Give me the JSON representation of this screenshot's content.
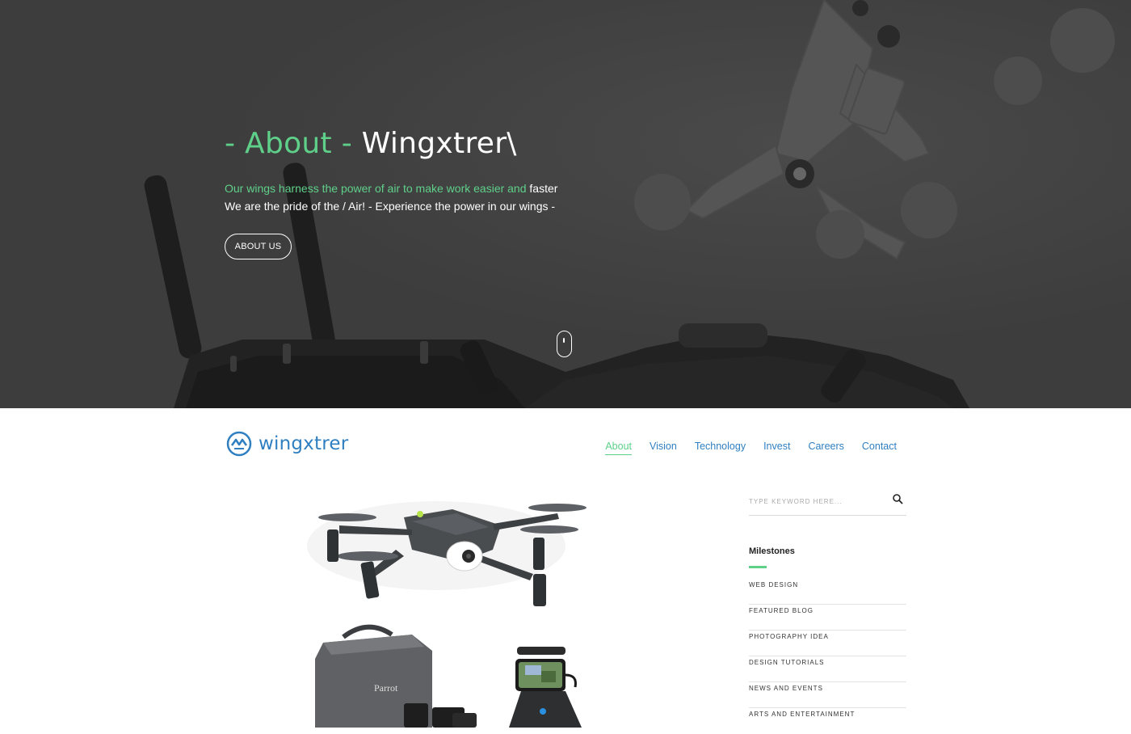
{
  "hero": {
    "title_prefix": "- About -",
    "title_main": " Wingxtrer\\",
    "line1_accent": "Our wings harness the power of air to make work easier and",
    "line1_rest": " faster",
    "line2": "We are the pride of the / Air! - Experience the power in our wings -",
    "button_label": "ABOUT US"
  },
  "header": {
    "brand": "wingxtrer",
    "nav": [
      {
        "label": "About",
        "active": true
      },
      {
        "label": "Vision"
      },
      {
        "label": "Technology"
      },
      {
        "label": "Invest"
      },
      {
        "label": "Careers"
      },
      {
        "label": "Contact"
      }
    ]
  },
  "sidebar": {
    "search_placeholder": "TYPE KEYWORD HERE...",
    "widget_title": "Milestones",
    "items": [
      "WEB DESIGN",
      "FEATURED BLOG",
      "PHOTOGRAPHY IDEA",
      "DESIGN TUTORIALS",
      "NEWS AND EVENTS",
      "ARTS AND ENTERTAINMENT"
    ]
  },
  "product": {
    "bag_brand": "Parrot"
  },
  "colors": {
    "accent": "#5fd08a",
    "brand": "#2f7fc1",
    "hero_bg": "#3d3d3d"
  }
}
